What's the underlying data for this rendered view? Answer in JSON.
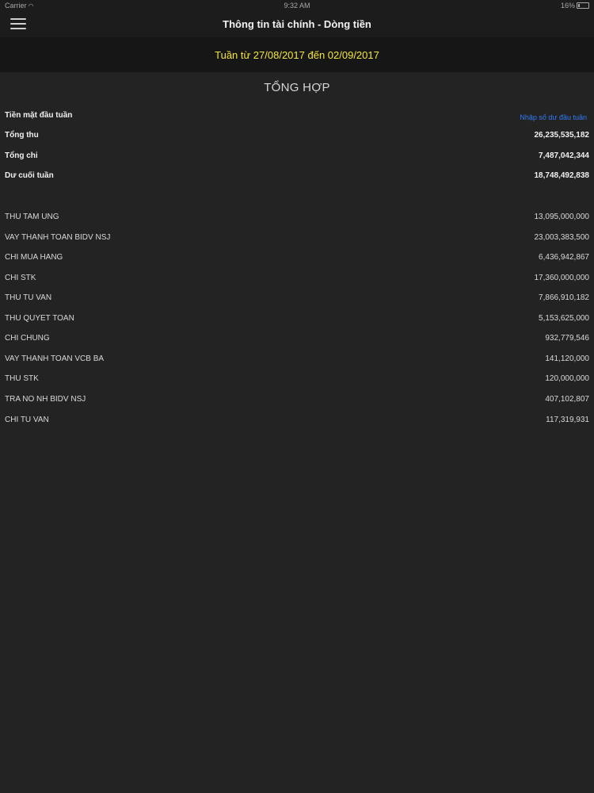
{
  "status_bar": {
    "carrier": "Carrier",
    "time": "9:32 AM",
    "battery": "16%"
  },
  "header": {
    "title": "Thông tin tài chính - Dòng tiền",
    "menu_icon": "hamburger-menu-icon"
  },
  "week": {
    "label": "Tuần từ 27/08/2017 đến 02/09/2017"
  },
  "summary": {
    "title": "TỔNG HỢP",
    "opening_label": "Tiền mặt đầu tuần",
    "opening_link": "Nhập số dư đầu tuần",
    "total_income_label": "Tổng thu",
    "total_income_value": "26,235,535,182",
    "total_expense_label": "Tổng chi",
    "total_expense_value": "7,487,042,344",
    "closing_label": "Dư cuối tuần",
    "closing_value": "18,748,492,838"
  },
  "items": [
    {
      "label": "THU TAM UNG",
      "value": "13,095,000,000"
    },
    {
      "label": "VAY THANH TOAN BIDV NSJ",
      "value": "23,003,383,500"
    },
    {
      "label": "CHI MUA HANG",
      "value": "6,436,942,867"
    },
    {
      "label": "CHI STK",
      "value": "17,360,000,000"
    },
    {
      "label": "THU TU VAN",
      "value": "7,866,910,182"
    },
    {
      "label": "THU QUYET TOAN",
      "value": "5,153,625,000"
    },
    {
      "label": "CHI CHUNG",
      "value": "932,779,546"
    },
    {
      "label": "VAY THANH TOAN VCB BA",
      "value": "141,120,000"
    },
    {
      "label": "THU STK",
      "value": "120,000,000"
    },
    {
      "label": "TRA NO NH BIDV NSJ",
      "value": "407,102,807"
    },
    {
      "label": "CHI TU VAN",
      "value": "117,319,931"
    }
  ],
  "colors": {
    "background": "#232324",
    "header": "#1c1c1d",
    "week_bar": "#161617",
    "week_text": "#f6e53a",
    "link": "#2f7cf6"
  }
}
